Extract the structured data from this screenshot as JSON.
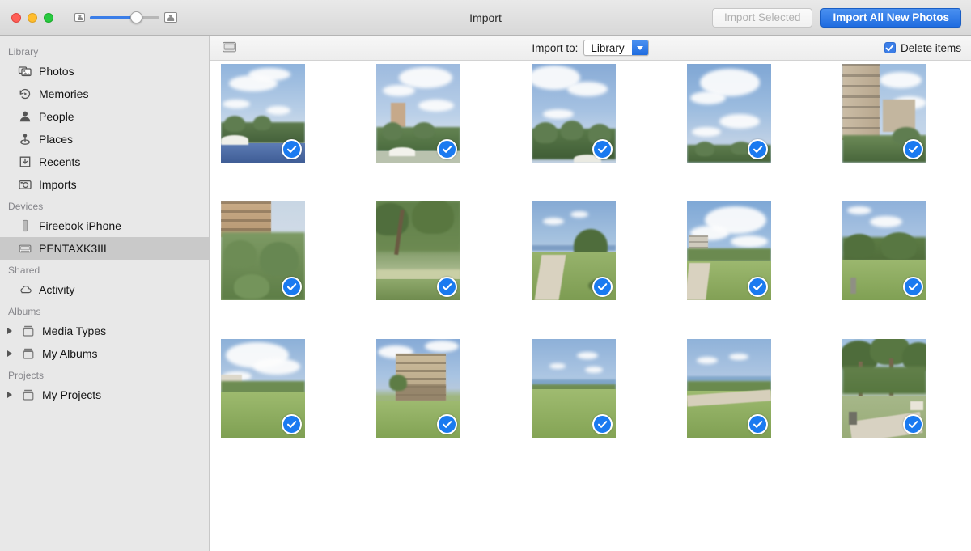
{
  "window": {
    "title": "Import",
    "traffic_lights": [
      "close-button",
      "minimize-button",
      "maximize-button"
    ]
  },
  "toolbar": {
    "zoom_slider": {
      "name": "thumbnail-size-slider",
      "value_percent": 62,
      "small_icon": "small-photo-icon",
      "large_icon": "large-photo-icon"
    },
    "import_selected_label": "Import Selected",
    "import_selected_enabled": false,
    "import_all_label": "Import All New Photos",
    "accent_color": "#1f6ce0"
  },
  "importbar": {
    "device_icon": "drive-icon",
    "import_to_label": "Import to:",
    "destination_value": "Library",
    "destination_options": [
      "Library"
    ],
    "delete_items_label": "Delete items",
    "delete_items_checked": true
  },
  "sidebar": {
    "sections": [
      {
        "title": "Library",
        "items": [
          {
            "label": "Photos",
            "icon": "photos-icon",
            "selected": false
          },
          {
            "label": "Memories",
            "icon": "memories-icon",
            "selected": false
          },
          {
            "label": "People",
            "icon": "people-icon",
            "selected": false
          },
          {
            "label": "Places",
            "icon": "places-icon",
            "selected": false
          },
          {
            "label": "Recents",
            "icon": "recents-icon",
            "selected": false
          },
          {
            "label": "Imports",
            "icon": "imports-icon",
            "selected": false
          }
        ]
      },
      {
        "title": "Devices",
        "items": [
          {
            "label": "Fireebok iPhone",
            "icon": "iphone-icon",
            "selected": false
          },
          {
            "label": "PENTAXK3III",
            "icon": "camera-device-icon",
            "selected": true
          }
        ]
      },
      {
        "title": "Shared",
        "items": [
          {
            "label": "Activity",
            "icon": "cloud-icon",
            "selected": false
          }
        ]
      },
      {
        "title": "Albums",
        "items": [
          {
            "label": "Media Types",
            "icon": "album-icon",
            "selected": false,
            "disclosure": true
          },
          {
            "label": "My Albums",
            "icon": "album-icon",
            "selected": false,
            "disclosure": true
          }
        ]
      },
      {
        "title": "Projects",
        "items": [
          {
            "label": "My Projects",
            "icon": "album-icon",
            "selected": false,
            "disclosure": true
          }
        ]
      }
    ]
  },
  "grid": {
    "columns": 5,
    "rows": 3,
    "total_thumbnails": 15,
    "all_selected": true,
    "thumbnails": [
      {
        "scene": "resort-pool-palms",
        "selected": true
      },
      {
        "scene": "sky-palms-umbrella",
        "selected": true
      },
      {
        "scene": "sky-palm-canopy",
        "selected": true
      },
      {
        "scene": "sky-clouds-treeline",
        "selected": true
      },
      {
        "scene": "condo-tower-greenery",
        "selected": true
      },
      {
        "scene": "resort-building-hedge",
        "selected": true
      },
      {
        "scene": "tree-canopy-lawn",
        "selected": true
      },
      {
        "scene": "lawn-path-ocean",
        "selected": true
      },
      {
        "scene": "lawn-building-clouds",
        "selected": true
      },
      {
        "scene": "lawn-trees-sky",
        "selected": true
      },
      {
        "scene": "lawn-clouds-building",
        "selected": true
      },
      {
        "scene": "hotel-facade-lawn",
        "selected": true
      },
      {
        "scene": "lawn-ocean-horizon",
        "selected": true
      },
      {
        "scene": "lawn-path-ocean-2",
        "selected": true
      },
      {
        "scene": "palm-grove-path",
        "selected": true
      }
    ]
  }
}
